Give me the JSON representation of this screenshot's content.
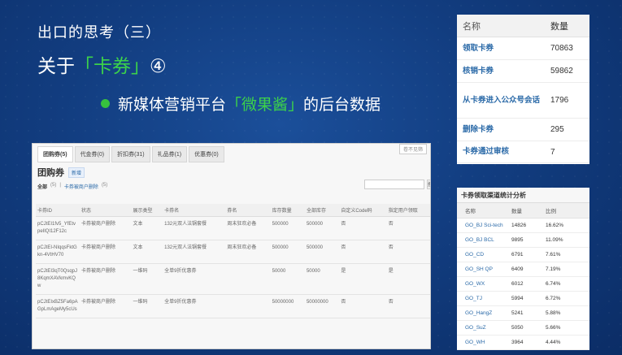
{
  "slide": {
    "subtitle": "出口的思考（三）",
    "title_prefix": "关于",
    "title_highlight": "「卡券」",
    "title_suffix": "④",
    "bullet_prefix": "新媒体营销平台",
    "bullet_highlight": "「微果酱」",
    "bullet_suffix": "的后台数据"
  },
  "panel": {
    "tabs": [
      "团购券(5)",
      "代金券(0)",
      "折扣券(31)",
      "礼品券(1)",
      "优惠券(0)"
    ],
    "corner_label": "卷不见筛",
    "heading": "团购券",
    "new_label": "新增",
    "filter_all": "全部",
    "filter_all_count": "(5)",
    "filter_sep": "|",
    "filter_deleted": "卡券被商户删除",
    "filter_deleted_count": "(5)",
    "search_btn": "搜",
    "columns": [
      "卡券ID",
      "状态",
      "展示类型",
      "卡券名",
      "券名",
      "库存数量",
      "全部库存",
      "自定义Code码",
      "指定用户领取"
    ],
    "rows": [
      [
        "pCJtEI1fv5_YfEtvpeIlQI12F12c",
        "卡券被商户删除",
        "文本",
        "132元双人法锅套餐",
        "周末狂欢必备",
        "500000",
        "500000",
        "否",
        "否"
      ],
      [
        "pCJtEI-NIqqsFktGkn-4VtHV70",
        "卡券被商户删除",
        "文本",
        "132元双人法锅套餐",
        "周末狂欢必备",
        "500000",
        "500000",
        "否",
        "否"
      ],
      [
        "pCJtEI3qT0QsqpJ8KqmXAVkmvKQw",
        "卡券被商户删除",
        "一维码",
        "全单9折优惠券",
        "",
        "50000",
        "50000",
        "是",
        "是"
      ],
      [
        "pCJtEIxBZ5Fa6pAGpLmAgeMy5cUs",
        "卡券被商户删除",
        "一维码",
        "全单9折优惠券",
        "",
        "50000000",
        "50000000",
        "否",
        "否"
      ]
    ]
  },
  "stats": {
    "col_name": "名称",
    "col_count": "数量",
    "rows": [
      {
        "name": "领取卡券",
        "count": "70863"
      },
      {
        "name": "核销卡券",
        "count": "59862"
      },
      {
        "name": "从卡券进入公众号会话",
        "count": "1796"
      },
      {
        "name": "删除卡券",
        "count": "295"
      },
      {
        "name": "卡券通过审核",
        "count": "7"
      }
    ]
  },
  "channels": {
    "title": "卡券领取渠道统计分析",
    "col_name": "名称",
    "col_count": "数量",
    "col_ratio": "比例",
    "rows": [
      {
        "name": "GO_BJ Sci-tech",
        "count": "14826",
        "ratio": "16.62%"
      },
      {
        "name": "GO_BJ BCL",
        "count": "9895",
        "ratio": "11.09%"
      },
      {
        "name": "GO_CD",
        "count": "6791",
        "ratio": "7.61%"
      },
      {
        "name": "GO_SH QP",
        "count": "6409",
        "ratio": "7.19%"
      },
      {
        "name": "GO_WX",
        "count": "6012",
        "ratio": "6.74%"
      },
      {
        "name": "GO_TJ",
        "count": "5994",
        "ratio": "6.72%"
      },
      {
        "name": "GO_HangZ",
        "count": "5241",
        "ratio": "5.88%"
      },
      {
        "name": "GO_SuZ",
        "count": "5050",
        "ratio": "5.66%"
      },
      {
        "name": "GO_WH",
        "count": "3964",
        "ratio": "4.44%"
      }
    ]
  }
}
